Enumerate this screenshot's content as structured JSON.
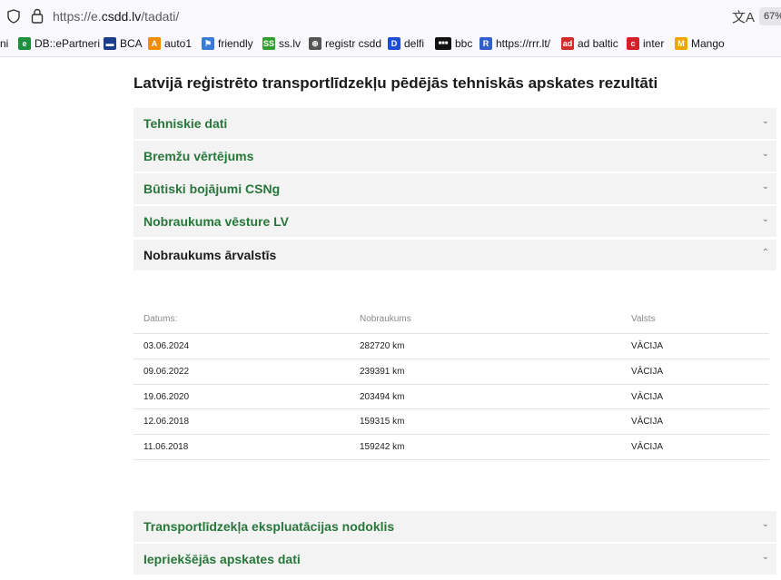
{
  "browser": {
    "url_prefix": "https://e.",
    "url_host": "csdd.lv",
    "url_path": "/tadati/",
    "zoom_badge": "67%"
  },
  "bookmarks": [
    {
      "label": "ni",
      "icon": "partial-bookmark-icon",
      "color": "#888888"
    },
    {
      "label": "DB::ePartneri",
      "icon": "db-epartneri-icon",
      "color": "#1e8f3e"
    },
    {
      "label": "BCA",
      "icon": "bca-icon",
      "color": "#1a3e8c"
    },
    {
      "label": "auto1",
      "icon": "auto1-icon",
      "color": "#f28c00"
    },
    {
      "label": "friendly",
      "icon": "friendly-flag-icon",
      "color": "#3a7bd5"
    },
    {
      "label": "ss.lv",
      "icon": "ss-icon",
      "color": "#2f9e2f"
    },
    {
      "label": "registr csdd",
      "icon": "globe-icon",
      "color": "#555555"
    },
    {
      "label": "delfi",
      "icon": "delfi-icon",
      "color": "#1f4fd1"
    },
    {
      "label": "bbc",
      "icon": "bbc-icon",
      "color": "#111111"
    },
    {
      "label": "https://rrr.lt/",
      "icon": "rrr-icon",
      "color": "#3160c8"
    },
    {
      "label": "ad baltic",
      "icon": "ad-baltic-icon",
      "color": "#d42a2a"
    },
    {
      "label": "inter",
      "icon": "inter-icon",
      "color": "#d62027"
    },
    {
      "label": "Mango",
      "icon": "mango-icon",
      "color": "#f2a500"
    }
  ],
  "page": {
    "title": "Latvijā reģistrēto transportlīdzekļu pēdējās tehniskās apskates rezultāti",
    "accent_color": "#27773a"
  },
  "sections_top": [
    {
      "label": "Tehniskie dati",
      "open": false
    },
    {
      "label": "Bremžu vērtējums",
      "open": false
    },
    {
      "label": "Būtiski bojājumi CSNg",
      "open": false
    },
    {
      "label": "Nobraukuma vēsture LV",
      "open": false
    },
    {
      "label": "Nobraukums ārvalstīs",
      "open": true
    }
  ],
  "mileage_table": {
    "headers": [
      "Datums:",
      "Nobraukums",
      "Valsts"
    ],
    "rows": [
      [
        "03.06.2024",
        "282720 km",
        "VĀCIJA"
      ],
      [
        "09.06.2022",
        "239391 km",
        "VĀCIJA"
      ],
      [
        "19.06.2020",
        "203494 km",
        "VĀCIJA"
      ],
      [
        "12.06.2018",
        "159315 km",
        "VĀCIJA"
      ],
      [
        "11.06.2018",
        "159242 km",
        "VĀCIJA"
      ]
    ]
  },
  "sections_bottom": [
    {
      "label": "Transportlīdzekļa ekspluatācijas nodoklis",
      "open": false
    },
    {
      "label": "Iepriekšējās apskates dati",
      "open": false
    }
  ]
}
